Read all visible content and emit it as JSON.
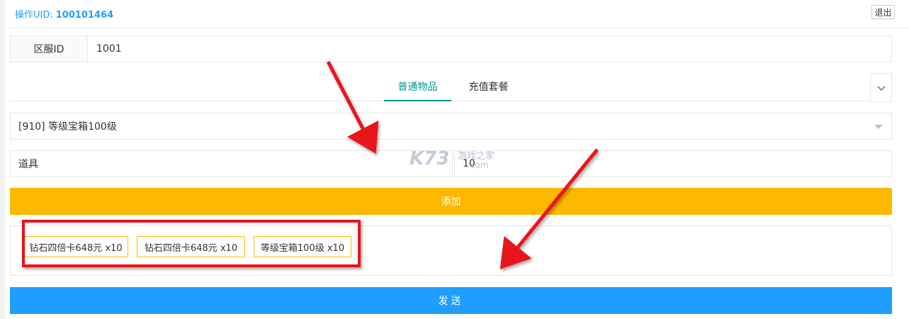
{
  "header": {
    "uid_label": "操作UID:",
    "uid_value": "100101464",
    "logout_label": "退出"
  },
  "server": {
    "label": "区服ID",
    "value": "1001"
  },
  "tabs": [
    {
      "label": "普通物品",
      "active": true
    },
    {
      "label": "充值套餐",
      "active": false
    }
  ],
  "item_select": {
    "selected": "[910] 等级宝箱100级"
  },
  "item_type": {
    "value": "道具"
  },
  "quantity": {
    "value": "10"
  },
  "add_button": {
    "label": "添加"
  },
  "added_items": [
    {
      "label": "钻石四倍卡648元 x10"
    },
    {
      "label": "钻石四倍卡648元 x10"
    },
    {
      "label": "等级宝箱100级 x10"
    }
  ],
  "send_button": {
    "label": "发送"
  },
  "watermark": {
    "logo": "K73",
    "site_name": "游戏之家",
    "domain": ".com"
  },
  "colors": {
    "accent": "#1e9fff",
    "tab_active": "#009688",
    "add_button": "#ffb800",
    "send_button": "#1e9fff",
    "annotation": "#e8141a"
  }
}
